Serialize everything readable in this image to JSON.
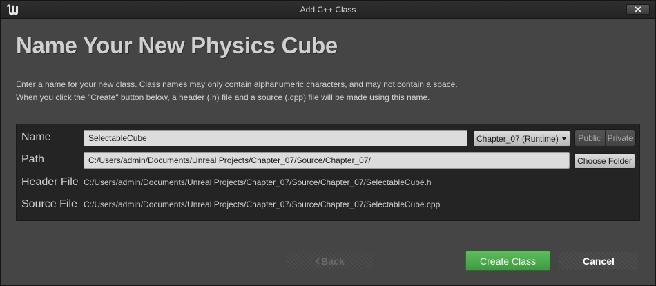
{
  "window": {
    "title": "Add C++ Class",
    "close_icon": "close-icon"
  },
  "header": {
    "heading": "Name Your New Physics Cube",
    "description_line1": "Enter a name for your new class. Class names may only contain alphanumeric characters, and may not contain a space.",
    "description_line2": "When you click the \"Create\" button below, a header (.h) file and a source (.cpp) file will be made using this name."
  },
  "form": {
    "name_label": "Name",
    "name_value": "SelectableCube",
    "module_value": "Chapter_07 (Runtime)",
    "public_label": "Public",
    "private_label": "Private",
    "path_label": "Path",
    "path_value": "C:/Users/admin/Documents/Unreal Projects/Chapter_07/Source/Chapter_07/",
    "choose_folder_label": "Choose Folder",
    "header_file_label": "Header File",
    "header_file_value": "C:/Users/admin/Documents/Unreal Projects/Chapter_07/Source/Chapter_07/SelectableCube.h",
    "source_file_label": "Source File",
    "source_file_value": "C:/Users/admin/Documents/Unreal Projects/Chapter_07/Source/Chapter_07/SelectableCube.cpp"
  },
  "footer": {
    "back_label": "Back",
    "create_label": "Create Class",
    "cancel_label": "Cancel"
  },
  "colors": {
    "accent_green": "#4caf50",
    "background": "#454545",
    "panel": "#242424"
  }
}
